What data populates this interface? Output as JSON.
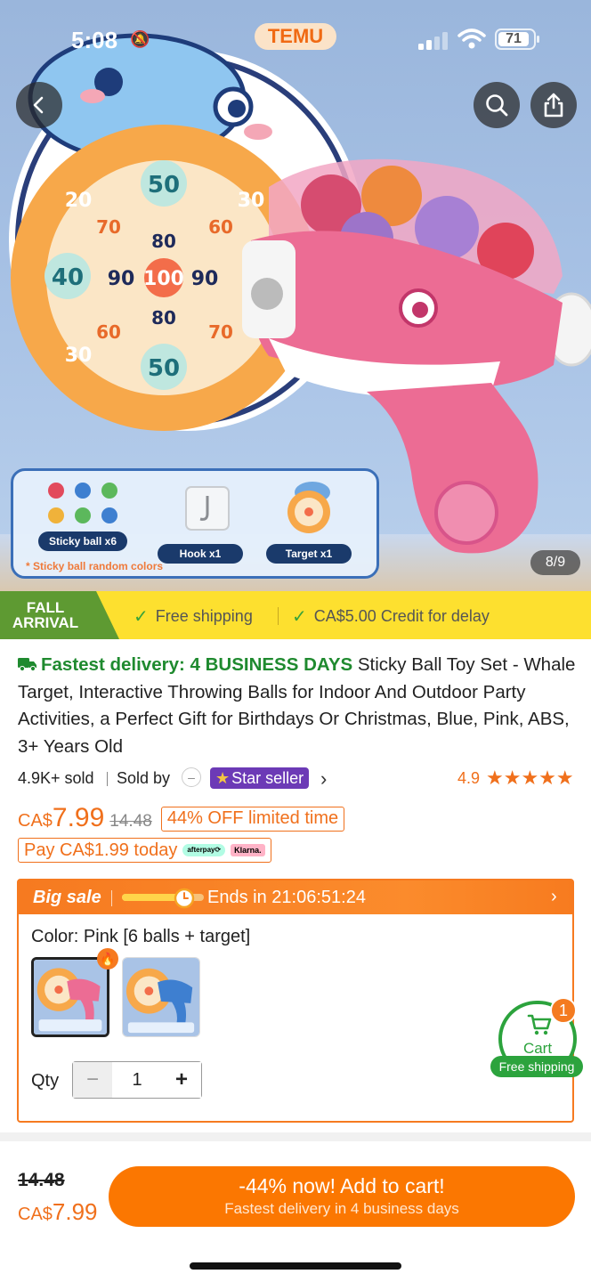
{
  "status_bar": {
    "time": "5:08",
    "app_name": "TEMU",
    "battery": "71"
  },
  "hero": {
    "target_scores": [
      "20",
      "50",
      "30",
      "70",
      "80",
      "60",
      "40",
      "90",
      "100",
      "90",
      "60",
      "80",
      "70",
      "30",
      "50"
    ],
    "kit_labels": {
      "balls": "Sticky ball x6",
      "hook": "Hook x1",
      "target": "Target x1"
    },
    "kit_note": "* Sticky ball random colors",
    "image_counter": "8/9"
  },
  "promo": {
    "tag_line1": "FALL",
    "tag_line2": "ARRIVAL",
    "item1": "Free shipping",
    "item2": "CA$5.00 Credit for delay"
  },
  "product": {
    "delivery": "Fastest delivery: 4 BUSINESS DAYS",
    "title": "Sticky Ball Toy Set - Whale Target, Interactive Throwing Balls for Indoor And Outdoor Party Activities, a Perfect Gift for Birthdays Or Christmas, Blue, Pink, ABS, 3+ Years Old",
    "sold": "4.9K+ sold",
    "sold_by": "Sold by",
    "seller_badge": "Star seller",
    "rating": "4.9",
    "stars": "★★★★★",
    "rating_value": 4.9
  },
  "price": {
    "currency": "CA$",
    "value": "7.99",
    "original": "14.48",
    "discount": "44% OFF limited time",
    "pay_today": "Pay CA$1.99 today",
    "afterpay": "afterpay⟳",
    "klarna": "Klarna."
  },
  "sale": {
    "title": "Big sale",
    "ends_label": "Ends in",
    "countdown": "21:06:51:24",
    "progress_fraction": 0.75,
    "color_label": "Color: Pink [6 balls + target]",
    "qty_label": "Qty",
    "qty_value": "1"
  },
  "cart": {
    "badge": "1",
    "label": "Cart",
    "free_shipping": "Free shipping"
  },
  "bottom": {
    "old_price": "14.48",
    "currency": "CA$",
    "new_price": "7.99",
    "cta_main": "-44% now! Add to cart!",
    "cta_sub": "Fastest delivery in 4 business days"
  },
  "colors": {
    "accent": "#fb7701",
    "green": "#2ca33d",
    "promo_yellow": "#fde02f",
    "star_seller": "#6c3ab6"
  }
}
